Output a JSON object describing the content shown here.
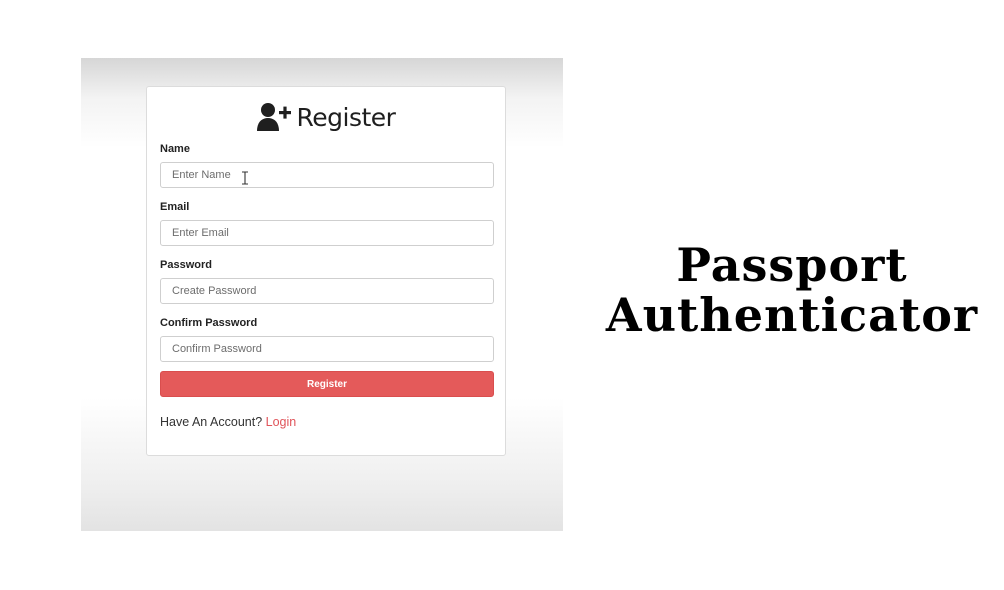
{
  "register_form": {
    "title": "Register",
    "fields": [
      {
        "label": "Name",
        "placeholder": "Enter Name"
      },
      {
        "label": "Email",
        "placeholder": "Enter Email"
      },
      {
        "label": "Password",
        "placeholder": "Create Password"
      },
      {
        "label": "Confirm Password",
        "placeholder": "Confirm Password"
      }
    ],
    "submit_label": "Register",
    "account_prompt": "Have An Account?",
    "login_link": "Login",
    "accent_color": "#e45a5a"
  },
  "headline": {
    "line1": "Passport",
    "line2": "Authenticator"
  }
}
